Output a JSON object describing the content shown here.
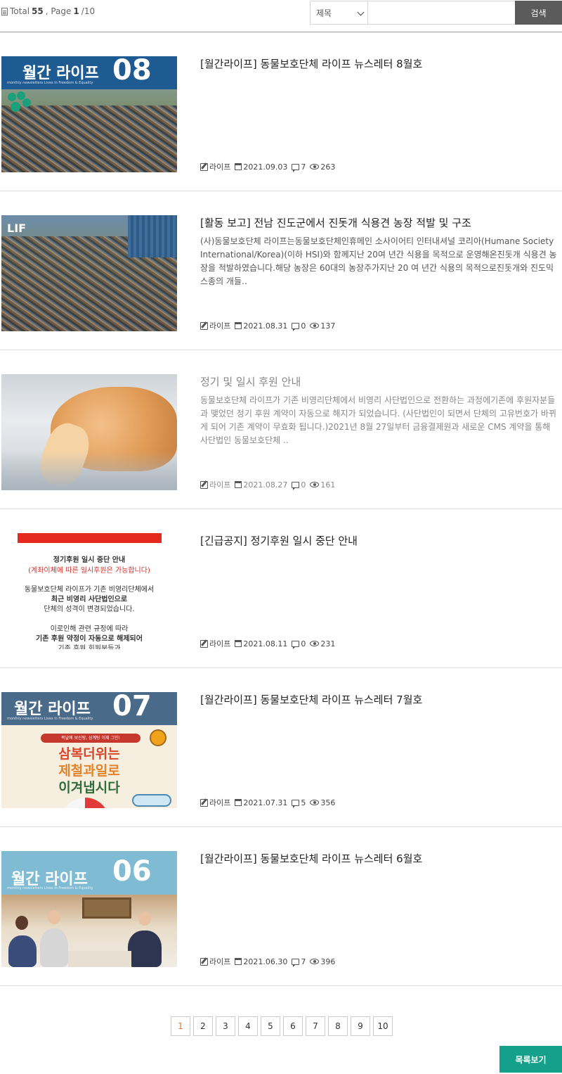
{
  "top": {
    "total_prefix": "Total",
    "total_count": "55",
    "page_prefix": ", Page",
    "page_current": "1",
    "page_suffix": "/10",
    "search_field": "제목",
    "search_value": "",
    "search_button": "검색"
  },
  "posts": [
    {
      "title": "[월간라이프] 동물보호단체 라이프 뉴스레터 8월호",
      "excerpt": "",
      "author": "라이프",
      "date": "2021.09.03",
      "comments": "7",
      "views": "263",
      "thumb": {
        "type": "newsletter",
        "name": "월간 라이프",
        "number": "08",
        "subtitle": "monthly newsletters Lives in Freedom & Equality",
        "band_color": "#1f5b93"
      }
    },
    {
      "title": "[활동 보고] 전남 진도군에서 진돗개 식용견 농장 적발 및 구조",
      "excerpt": "(사)동물보호단체 라이프는동물보호단체인휴메인 소사이어티 인터내셔널 코리아(Humane Society International/Korea)(이하 HSI)와 함께지난 20여 년간 식용을 목적으로 운영해온진돗개 식용견 농장을 적발하였습니다.해당 농장은 60대의 농장주가지난 20 여 년간 식용의 목적으로진돗개와 진도믹스종의 개들..",
      "author": "라이프",
      "date": "2021.08.31",
      "comments": "0",
      "views": "137",
      "thumb": {
        "type": "farm"
      }
    },
    {
      "title": "정기 및 일시 후원 안내",
      "excerpt": "동물보호단체 라이프가 기존 비영리단체에서 비영리 사단법인으로 전환하는 과정에기존에 후원자분들과 맺었던 정기 후원 계약이 자동으로 해지가 되었습니다. (사단법인이 되면서 단체의 고유번호가 바뀌게 되어 기존 계약이 무효화 됩니다.)2021년 8월 27일부터 금융결제원과 새로운 CMS 계약을 통해 사단법인 동물보호단체 ..",
      "author": "라이프",
      "date": "2021.08.27",
      "comments": "0",
      "views": "161",
      "thumb": {
        "type": "cat"
      }
    },
    {
      "title": "[긴급공지] 정기후원 일시 중단 안내",
      "excerpt": "",
      "author": "라이프",
      "date": "2021.08.11",
      "comments": "0",
      "views": "231",
      "thumb": {
        "type": "notice",
        "line1": "정기후원 일시 중단 안내",
        "line2": "(계좌이체에 따른 일시후원은 가능합니다)",
        "line3": "동물보호단체 라이프가 기존 비영리단체에서",
        "line4": "최근 비영리 사단법인으로",
        "line5": "단체의 성격이 변경되었습니다.",
        "line6": "이로인해 관련 규정에 따라",
        "line7": "기존 후원 약정이 자동으로 해제되어",
        "line8": "기존 후원 회원분들과"
      }
    },
    {
      "title": "[월간라이프] 동물보호단체 라이프 뉴스레터 7월호",
      "excerpt": "",
      "author": "라이프",
      "date": "2021.07.31",
      "comments": "5",
      "views": "356",
      "thumb": {
        "type": "newsletter",
        "name": "월간 라이프",
        "number": "07",
        "subtitle": "monthly newsletters Lives in Freedom & Equality",
        "band_color": "#4a6a8a",
        "strip": "복날에 보신탕, 삼계탕 이제 그만!",
        "line_a": "삼복더위는",
        "line_b": "제철과일로",
        "line_c": "이겨냅시다"
      }
    },
    {
      "title": "[월간라이프] 동물보호단체 라이프 뉴스레터 6월호",
      "excerpt": "",
      "author": "라이프",
      "date": "2021.06.30",
      "comments": "7",
      "views": "396",
      "thumb": {
        "type": "newsletter",
        "name": "월간 라이프",
        "number": "06",
        "subtitle": "monthly newsletters Lives in Freedom & Equality",
        "band_color": "#7fbcd3"
      }
    }
  ],
  "pagination": {
    "pages": [
      "1",
      "2",
      "3",
      "4",
      "5",
      "6",
      "7",
      "8",
      "9",
      "10"
    ],
    "current": "1"
  },
  "list_button": "목록보기"
}
